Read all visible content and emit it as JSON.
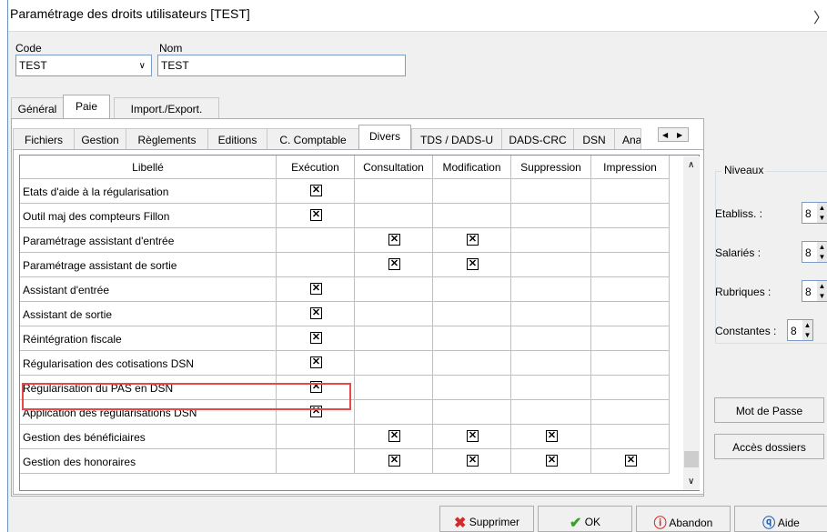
{
  "window": {
    "title": "Paramétrage des droits utilisateurs [TEST]"
  },
  "form": {
    "code_label": "Code",
    "code_value": "TEST",
    "nom_label": "Nom",
    "nom_value": "TEST"
  },
  "main_tabs": [
    {
      "label": "Général",
      "active": false
    },
    {
      "label": "Paie",
      "active": true
    },
    {
      "label": "Import./Export.",
      "active": false
    }
  ],
  "sub_tabs": [
    {
      "label": "Fichiers",
      "active": false
    },
    {
      "label": "Gestion",
      "active": false
    },
    {
      "label": "Règlements",
      "active": false
    },
    {
      "label": "Editions",
      "active": false
    },
    {
      "label": "C. Comptable",
      "active": false
    },
    {
      "label": "Divers",
      "active": true
    },
    {
      "label": "TDS / DADS-U",
      "active": false
    },
    {
      "label": "DADS-CRC",
      "active": false
    },
    {
      "label": "DSN",
      "active": false
    },
    {
      "label": "Ana",
      "active": false
    }
  ],
  "grid": {
    "columns": [
      "Libellé",
      "Exécution",
      "Consultation",
      "Modification",
      "Suppression",
      "Impression"
    ],
    "rows": [
      {
        "label": "Etats d'aide à la régularisation",
        "checks": [
          true,
          false,
          false,
          false,
          false
        ]
      },
      {
        "label": "Outil maj des compteurs Fillon",
        "checks": [
          true,
          false,
          false,
          false,
          false
        ]
      },
      {
        "label": "Paramétrage assistant d'entrée",
        "checks": [
          false,
          true,
          true,
          false,
          false
        ]
      },
      {
        "label": "Paramétrage assistant de sortie",
        "checks": [
          false,
          true,
          true,
          false,
          false
        ]
      },
      {
        "label": "Assistant d'entrée",
        "checks": [
          true,
          false,
          false,
          false,
          false
        ]
      },
      {
        "label": "Assistant de sortie",
        "checks": [
          true,
          false,
          false,
          false,
          false
        ]
      },
      {
        "label": "Réintégration fiscale",
        "checks": [
          true,
          false,
          false,
          false,
          false
        ]
      },
      {
        "label": "Régularisation des cotisations DSN",
        "checks": [
          true,
          false,
          false,
          false,
          false
        ]
      },
      {
        "label": "Régularisation du PAS en DSN",
        "checks": [
          true,
          false,
          false,
          false,
          false
        ]
      },
      {
        "label": "Application des régularisations DSN",
        "checks": [
          true,
          false,
          false,
          false,
          false
        ]
      },
      {
        "label": "Gestion des bénéficiaires",
        "checks": [
          false,
          true,
          true,
          true,
          false
        ]
      },
      {
        "label": "Gestion des honoraires",
        "checks": [
          false,
          true,
          true,
          true,
          true
        ]
      }
    ]
  },
  "niveaux": {
    "title": "Niveaux",
    "items": [
      {
        "label": "Etabliss. :",
        "value": "8"
      },
      {
        "label": "Salariés :",
        "value": "8"
      },
      {
        "label": "Rubriques :",
        "value": "8"
      },
      {
        "label": "Constantes :",
        "value": "8"
      }
    ]
  },
  "side_buttons": {
    "mot_de_passe": "Mot de Passe",
    "acces_dossiers": "Accès dossiers"
  },
  "bottom_buttons": {
    "supprimer": "Supprimer",
    "ok": "OK",
    "abandon": "Abandon",
    "aide": "Aide"
  },
  "icons": {
    "check_mark": "☒",
    "close": "close-icon"
  }
}
